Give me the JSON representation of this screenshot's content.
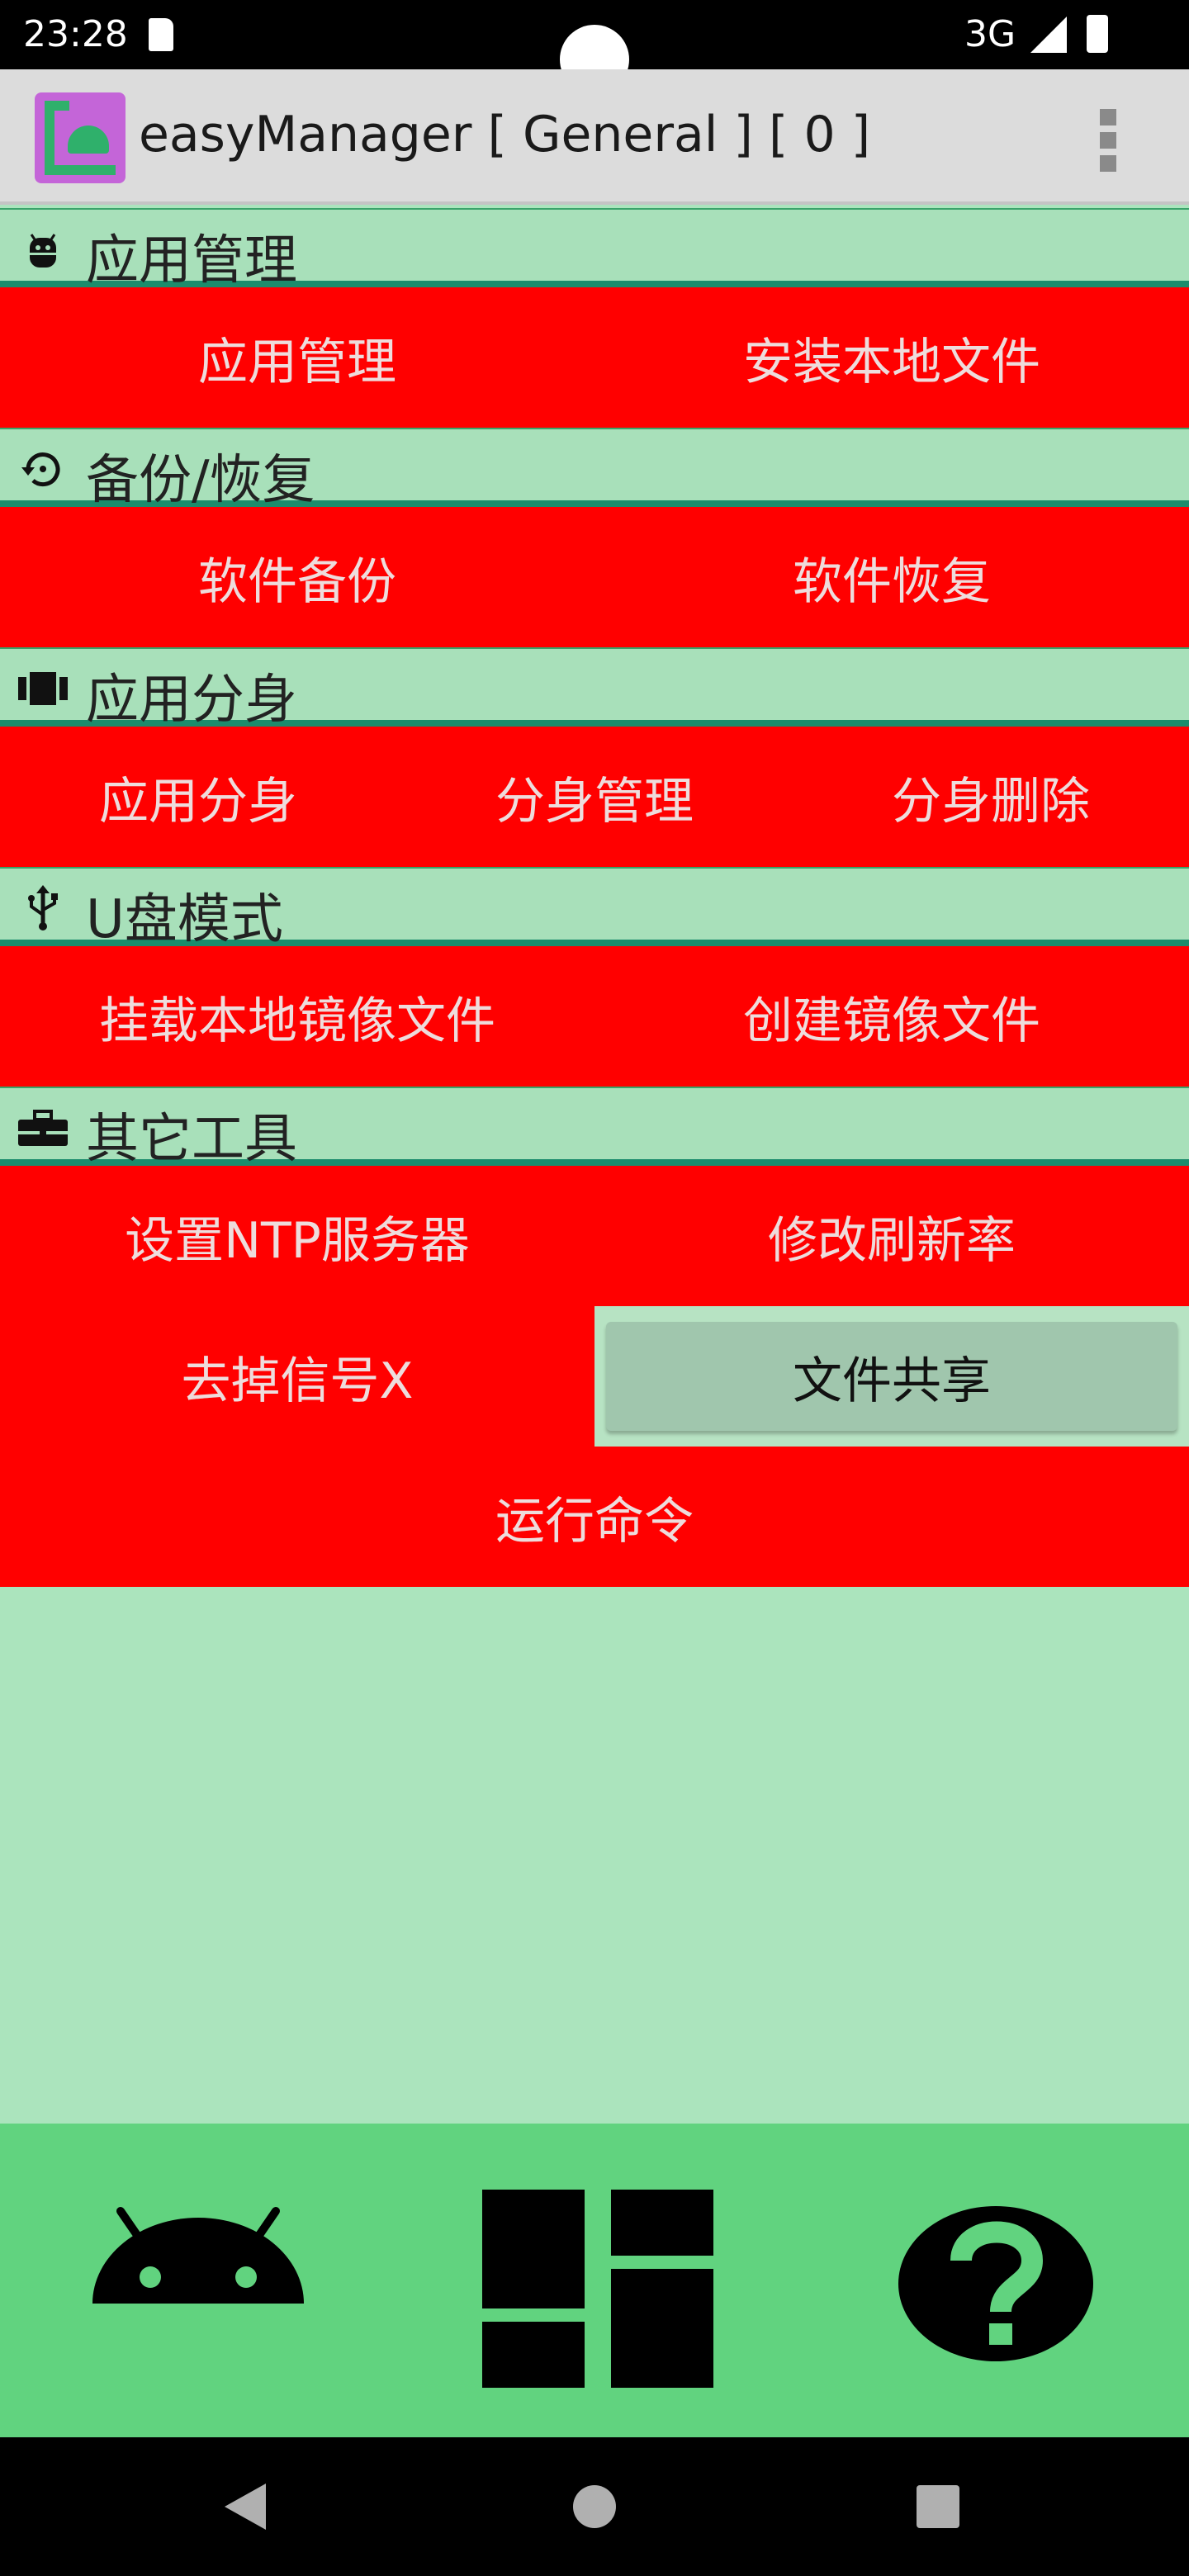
{
  "status_bar": {
    "time": "23:28",
    "network": "3G"
  },
  "toolbar": {
    "title": "easyManager [ General ] [ 0 ]"
  },
  "sections": [
    {
      "icon": "android-head-icon",
      "title": "应用管理",
      "rows": [
        [
          "应用管理",
          "安装本地文件"
        ]
      ]
    },
    {
      "icon": "restore-icon",
      "title": "备份/恢复",
      "rows": [
        [
          "软件备份",
          "软件恢复"
        ]
      ]
    },
    {
      "icon": "clone-icon",
      "title": "应用分身",
      "rows": [
        [
          "应用分身",
          "分身管理",
          "分身删除"
        ]
      ]
    },
    {
      "icon": "usb-icon",
      "title": "U盘模式",
      "rows": [
        [
          "挂载本地镜像文件",
          "创建镜像文件"
        ]
      ]
    },
    {
      "icon": "toolbox-icon",
      "title": "其它工具",
      "rows": [
        [
          "设置NTP服务器",
          "修改刷新率"
        ],
        [
          "去掉信号X",
          "文件共享"
        ],
        [
          "运行命令"
        ]
      ]
    }
  ],
  "bottom_nav": {
    "items": [
      "android-icon",
      "dashboard-icon",
      "help-icon"
    ]
  },
  "colors": {
    "button_bg": "#ff0000",
    "section_bg": "#a8e0ba",
    "nav_bg": "#61d37f",
    "divider": "#1c8c6c"
  }
}
